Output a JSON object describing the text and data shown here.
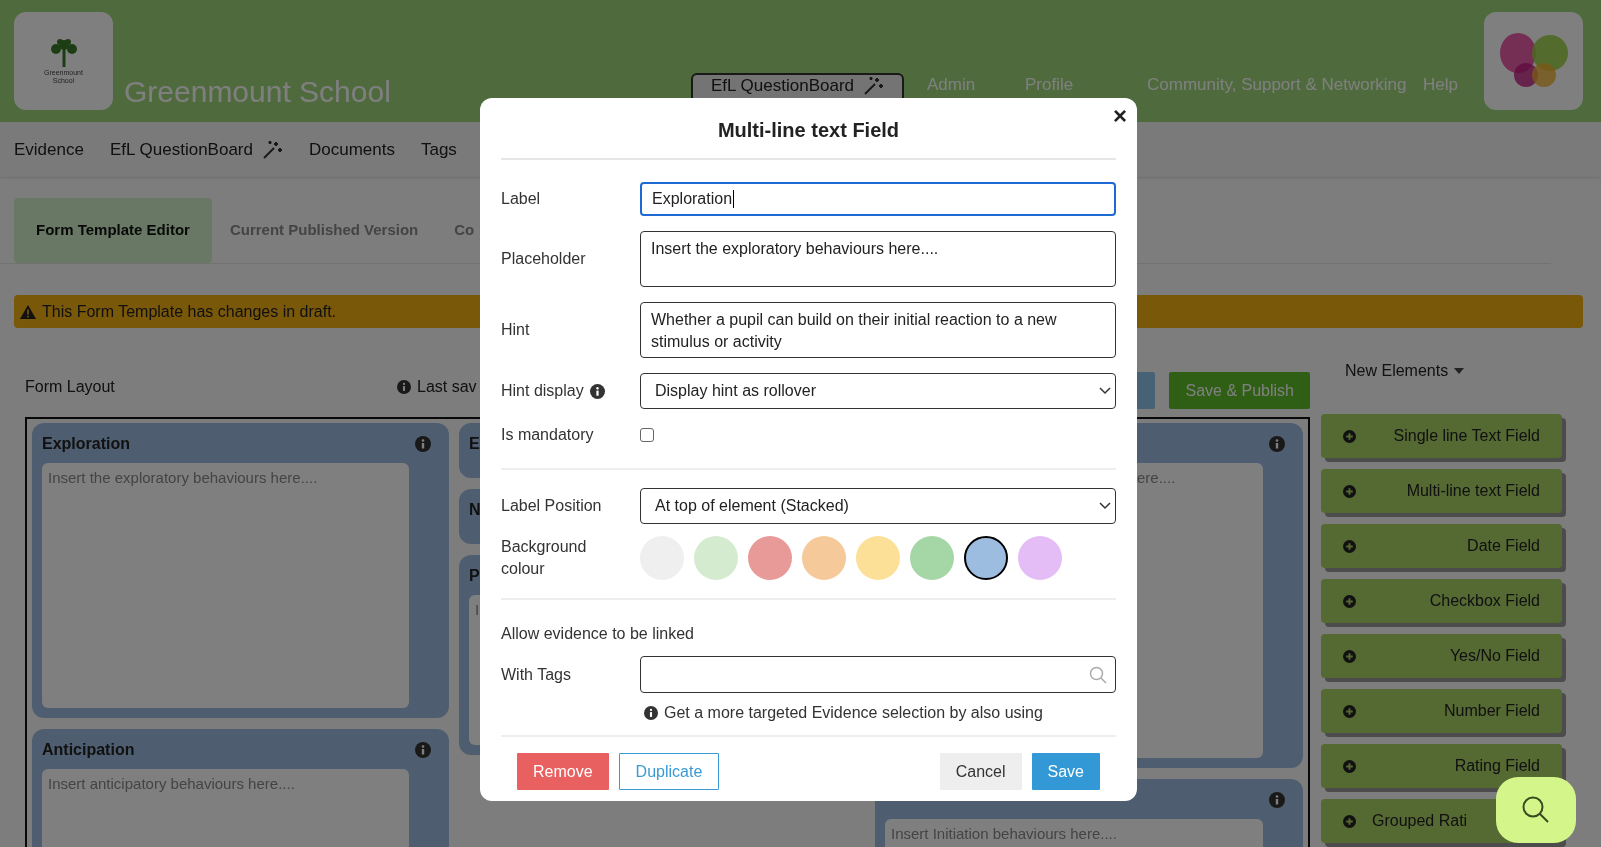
{
  "header": {
    "logo_text": "Greenmount School",
    "school_name": "Greenmount School",
    "nav": [
      {
        "label": "EfL QuestionBoard",
        "kind": "tab"
      },
      {
        "label": "Admin",
        "kind": "dropdown"
      },
      {
        "label": "Profile",
        "kind": "dropdown"
      },
      {
        "label": "Community, Support & Networking",
        "kind": "link"
      },
      {
        "label": "Help",
        "kind": "link"
      }
    ]
  },
  "subnav": [
    {
      "label": "Evidence",
      "kind": "plain"
    },
    {
      "label": "EfL QuestionBoard",
      "kind": "wand"
    },
    {
      "label": "Documents",
      "kind": "plain"
    },
    {
      "label": "Tags",
      "kind": "plain"
    }
  ],
  "page_tabs": [
    {
      "label": "Form Template Editor",
      "selected": true
    },
    {
      "label": "Current Published Version",
      "selected": false
    },
    {
      "label": "Co",
      "selected": false
    }
  ],
  "alert": "This Form Template has changes in draft.",
  "form_layout": {
    "title": "Form Layout",
    "last_saved": "Last sav",
    "save_publish": "Save & Publish",
    "columns": [
      [
        {
          "title": "Exploration",
          "placeholder": "Insert the exploratory behaviours here...."
        },
        {
          "title": "Anticipation",
          "placeholder": "Insert anticipatory behaviours here...."
        }
      ],
      [
        {
          "title": "E"
        },
        {
          "title": "N"
        },
        {
          "title": "P",
          "placeholder": "I"
        }
      ],
      [
        {
          "placeholder": "ere...."
        },
        {
          "placeholder": "Insert Initiation behaviours here...."
        }
      ]
    ]
  },
  "new_elements": {
    "title": "New Elements",
    "items": [
      "Single line Text Field",
      "Multi-line text Field",
      "Date Field",
      "Checkbox Field",
      "Yes/No Field",
      "Number Field",
      "Rating Field",
      "Grouped Rati"
    ]
  },
  "modal": {
    "title": "Multi-line text Field",
    "close": "×",
    "sections": [
      [
        {
          "kind": "text",
          "label": "Label",
          "value": "Exploration",
          "focused": true
        },
        {
          "kind": "textarea",
          "label": "Placeholder",
          "value": "Insert the exploratory behaviours here...."
        },
        {
          "kind": "textarea",
          "label": "Hint",
          "value": "Whether a pupil can build on their initial reaction to a new stimulus or activity"
        },
        {
          "kind": "select",
          "label": "Hint display",
          "info": true,
          "value": "Display hint as rollover"
        },
        {
          "kind": "checkbox",
          "label": "Is mandatory",
          "checked": false
        }
      ],
      [
        {
          "kind": "select",
          "label": "Label Position",
          "value": "At top of element (Stacked)"
        },
        {
          "kind": "swatches",
          "label": "Background colour",
          "swatches": [
            {
              "color": "#efefef",
              "selected": false
            },
            {
              "color": "#d5ebd0",
              "selected": false
            },
            {
              "color": "#e89a98",
              "selected": false
            },
            {
              "color": "#f5c99a",
              "selected": false
            },
            {
              "color": "#fde097",
              "selected": false
            },
            {
              "color": "#a5d6a5",
              "selected": false
            },
            {
              "color": "#9dbde0",
              "selected": true
            },
            {
              "color": "#e4bdf6",
              "selected": false
            }
          ]
        }
      ],
      [
        {
          "kind": "heading",
          "label": "Allow evidence to be linked"
        },
        {
          "kind": "search",
          "label": "With Tags"
        },
        {
          "kind": "note",
          "label": "Get a more targeted Evidence selection by also using"
        }
      ]
    ],
    "buttons": [
      {
        "label": "Remove",
        "kind": "danger"
      },
      {
        "label": "Duplicate",
        "kind": "outline"
      },
      {
        "label": "Cancel",
        "kind": "secondary"
      },
      {
        "label": "Save",
        "kind": "primary"
      }
    ]
  }
}
